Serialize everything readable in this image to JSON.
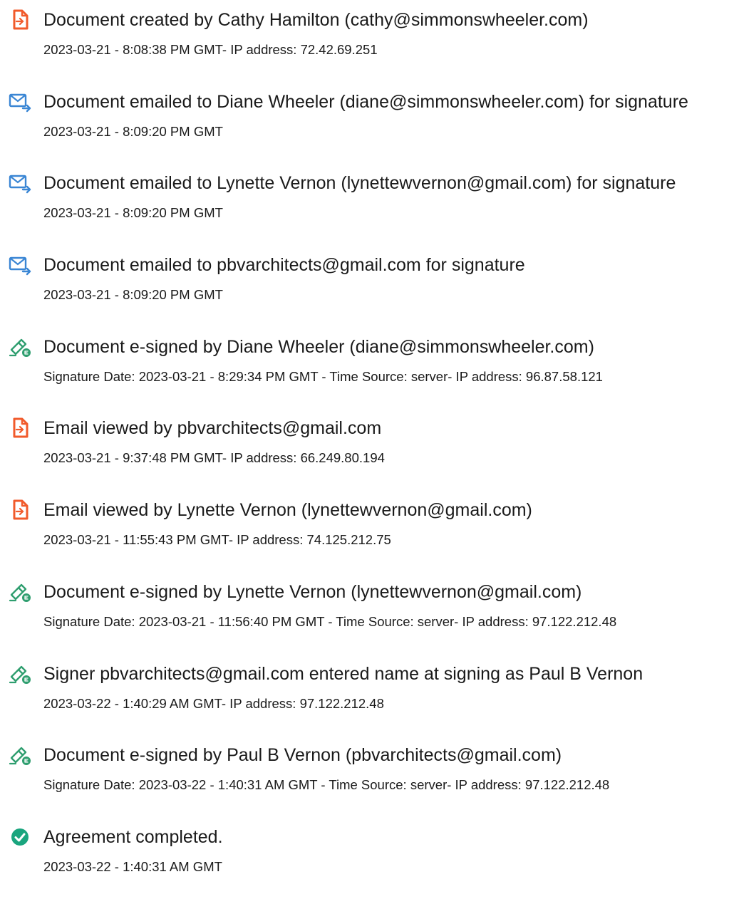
{
  "colors": {
    "doc_icon": "#f15a2b",
    "email_icon": "#3a86d4",
    "esign_icon": "#2f9e6f",
    "complete_icon": "#1aa57e",
    "text": "#1a1a1a"
  },
  "events": [
    {
      "icon": "document-icon",
      "title": "Document created by Cathy Hamilton (cathy@simmonswheeler.com)",
      "detail": "2023-03-21 - 8:08:38 PM GMT- IP address: 72.42.69.251"
    },
    {
      "icon": "email-sent-icon",
      "title": "Document emailed to Diane Wheeler (diane@simmonswheeler.com) for signature",
      "detail": "2023-03-21 - 8:09:20 PM GMT"
    },
    {
      "icon": "email-sent-icon",
      "title": "Document emailed to Lynette Vernon (lynettewvernon@gmail.com) for signature",
      "detail": "2023-03-21 - 8:09:20 PM GMT"
    },
    {
      "icon": "email-sent-icon",
      "title": "Document emailed to pbvarchitects@gmail.com for signature",
      "detail": "2023-03-21 - 8:09:20 PM GMT"
    },
    {
      "icon": "esign-pen-icon",
      "title": "Document e-signed by Diane Wheeler (diane@simmonswheeler.com)",
      "detail": "Signature Date: 2023-03-21 - 8:29:34 PM GMT - Time Source: server- IP address: 96.87.58.121"
    },
    {
      "icon": "document-icon",
      "title": "Email viewed by pbvarchitects@gmail.com",
      "detail": "2023-03-21 - 9:37:48 PM GMT- IP address: 66.249.80.194"
    },
    {
      "icon": "document-icon",
      "title": "Email viewed by Lynette Vernon (lynettewvernon@gmail.com)",
      "detail": "2023-03-21 - 11:55:43 PM GMT- IP address: 74.125.212.75"
    },
    {
      "icon": "esign-pen-icon",
      "title": "Document e-signed by Lynette Vernon (lynettewvernon@gmail.com)",
      "detail": "Signature Date: 2023-03-21 - 11:56:40 PM GMT - Time Source: server- IP address: 97.122.212.48"
    },
    {
      "icon": "esign-pen-icon",
      "title": "Signer pbvarchitects@gmail.com entered name at signing as Paul B Vernon",
      "detail": "2023-03-22 - 1:40:29 AM GMT- IP address: 97.122.212.48"
    },
    {
      "icon": "esign-pen-icon",
      "title": "Document e-signed by Paul B Vernon (pbvarchitects@gmail.com)",
      "detail": "Signature Date: 2023-03-22 - 1:40:31 AM GMT - Time Source: server- IP address: 97.122.212.48"
    },
    {
      "icon": "checkmark-circle-icon",
      "title": "Agreement completed.",
      "detail": "2023-03-22 - 1:40:31 AM GMT"
    }
  ]
}
